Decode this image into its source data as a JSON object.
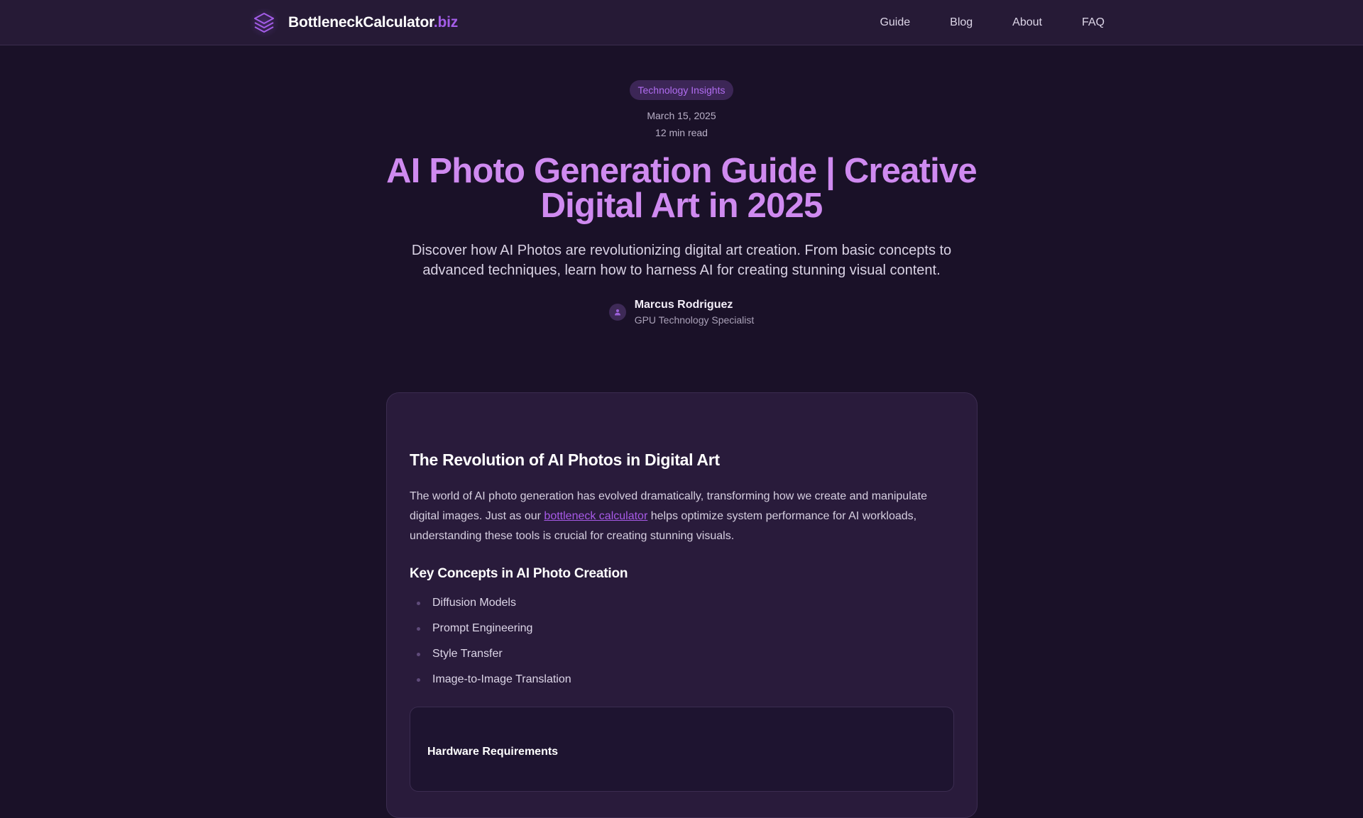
{
  "header": {
    "brand_name": "BottleneckCalculator",
    "brand_tld": ".biz",
    "logo_icon": "layers-icon",
    "nav": [
      {
        "label": "Guide"
      },
      {
        "label": "Blog"
      },
      {
        "label": "About"
      },
      {
        "label": "FAQ"
      }
    ]
  },
  "article": {
    "category": "Technology Insights",
    "date": "March 15, 2025",
    "read_time": "12 min read",
    "title": "AI Photo Generation Guide | Creative Digital Art in 2025",
    "lead": "Discover how AI Photos are revolutionizing digital art creation. From basic concepts to advanced techniques, learn how to harness AI for creating stunning visual content.",
    "author": {
      "name": "Marcus Rodriguez",
      "role": "GPU Technology Specialist",
      "avatar_icon": "user-icon"
    },
    "section_heading": "The Revolution of AI Photos in Digital Art",
    "paragraph_before_link": "The world of AI photo generation has evolved dramatically, transforming how we create and manipulate digital images. Just as our ",
    "paragraph_link": "bottleneck calculator",
    "paragraph_after_link": " helps optimize system performance for AI workloads, understanding these tools is crucial for creating stunning visuals.",
    "concepts_heading": "Key Concepts in AI Photo Creation",
    "concepts": [
      "Diffusion Models",
      "Prompt Engineering",
      "Style Transfer",
      "Image-to-Image Translation"
    ],
    "hardware_heading": "Hardware Requirements"
  },
  "colors": {
    "background": "#1a1128",
    "accent": "#a45de8",
    "title": "#cf8af0",
    "card": "#291b3b"
  }
}
